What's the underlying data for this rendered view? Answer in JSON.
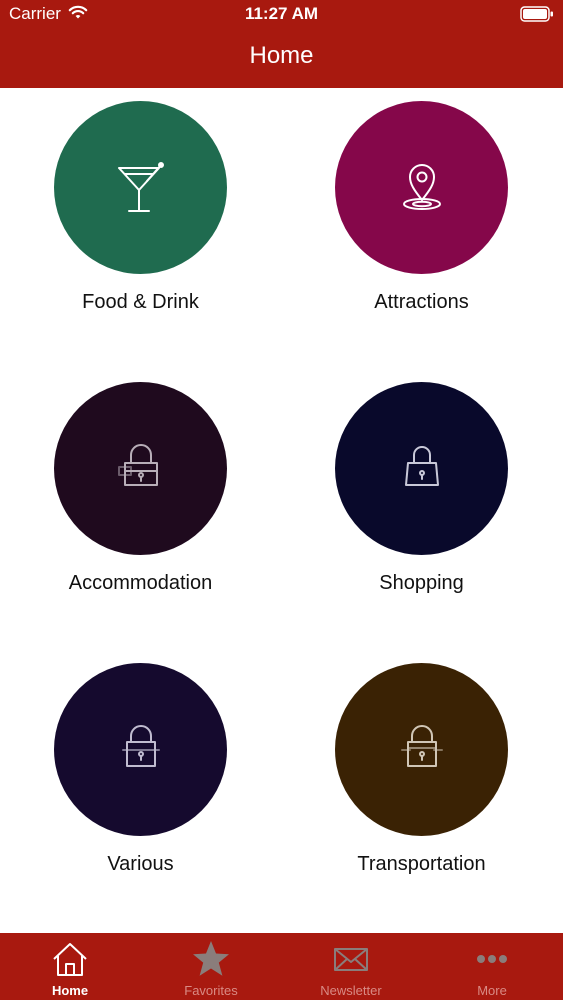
{
  "status_bar": {
    "carrier": "Carrier",
    "time": "11:27 AM"
  },
  "nav": {
    "title": "Home"
  },
  "categories": [
    {
      "label": "Food & Drink",
      "color": "#1f6b4f",
      "icon": "cocktail-icon"
    },
    {
      "label": "Attractions",
      "color": "#85074a",
      "icon": "map-pin-icon"
    },
    {
      "label": "Accommodation",
      "color": "#1f0a1e",
      "icon": "bag-icon"
    },
    {
      "label": "Shopping",
      "color": "#09092b",
      "icon": "bag-icon"
    },
    {
      "label": "Various",
      "color": "#150a2e",
      "icon": "bag-icon"
    },
    {
      "label": "Transportation",
      "color": "#3a2204",
      "icon": "bag-icon"
    }
  ],
  "tabbar": {
    "background": "#a8190f",
    "items": [
      {
        "label": "Home",
        "icon": "home-icon",
        "active": true
      },
      {
        "label": "Favorites",
        "icon": "star-icon",
        "active": false
      },
      {
        "label": "Newsletter",
        "icon": "envelope-icon",
        "active": false
      },
      {
        "label": "More",
        "icon": "more-dots-icon",
        "active": false
      }
    ]
  }
}
